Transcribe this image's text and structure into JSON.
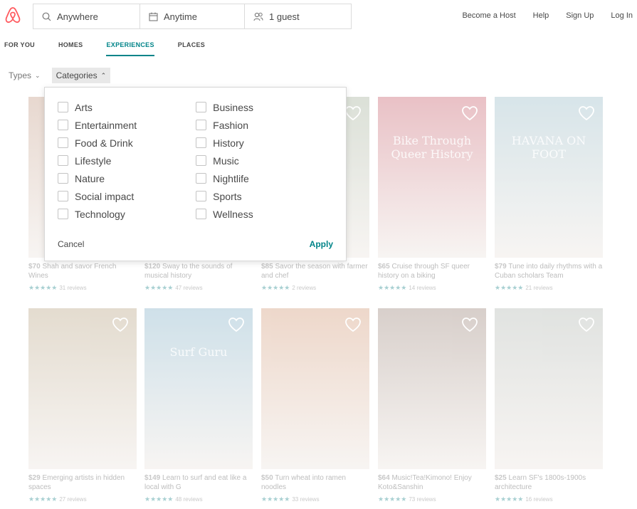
{
  "header": {
    "search": {
      "where": "Anywhere",
      "when": "Anytime",
      "guests": "1 guest"
    },
    "nav": [
      "Become a Host",
      "Help",
      "Sign Up",
      "Log In"
    ]
  },
  "tabs": [
    {
      "label": "FOR YOU",
      "active": false
    },
    {
      "label": "HOMES",
      "active": false
    },
    {
      "label": "EXPERIENCES",
      "active": true
    },
    {
      "label": "PLACES",
      "active": false
    }
  ],
  "filters": {
    "types": "Types",
    "categories": "Categories"
  },
  "categories_panel": {
    "left": [
      "Arts",
      "Entertainment",
      "Food & Drink",
      "Lifestyle",
      "Nature",
      "Social impact",
      "Technology"
    ],
    "right": [
      "Business",
      "Fashion",
      "History",
      "Music",
      "Nightlife",
      "Sports",
      "Wellness"
    ],
    "cancel": "Cancel",
    "apply": "Apply"
  },
  "cards": [
    {
      "price": "$70",
      "title": "Shah and savor French Wines",
      "stars": "★★★★★",
      "reviews": "31 reviews",
      "color": "#d4b8a8",
      "overlay": ""
    },
    {
      "price": "$120",
      "title": "Sway to the sounds of musical history",
      "stars": "★★★★★",
      "reviews": "47 reviews",
      "color": "#c8c0b0",
      "overlay": ""
    },
    {
      "price": "$85",
      "title": "Savor the season with farmer and chef",
      "stars": "★★★★★",
      "reviews": "2 reviews",
      "color": "#bfc8b8",
      "overlay": ""
    },
    {
      "price": "$65",
      "title": "Cruise through SF queer history on a biking",
      "stars": "★★★★★",
      "reviews": "14 reviews",
      "color": "#d88f98",
      "overlay": "Bike Through Queer History"
    },
    {
      "price": "$79",
      "title": "Tune into daily rhythms with a Cuban scholars Team",
      "stars": "★★★★★",
      "reviews": "21 reviews",
      "color": "#b8d0d8",
      "overlay": "HAVANA ON FOOT"
    },
    {
      "price": "$29",
      "title": "Emerging artists in hidden spaces",
      "stars": "★★★★★",
      "reviews": "27 reviews",
      "color": "#cdbfa8",
      "overlay": ""
    },
    {
      "price": "$149",
      "title": "Learn to surf and eat like a local with G",
      "stars": "★★★★★",
      "reviews": "48 reviews",
      "color": "#a8c8d8",
      "overlay": "Surf Guru"
    },
    {
      "price": "$50",
      "title": "Turn wheat into ramen noodles",
      "stars": "★★★★★",
      "reviews": "33 reviews",
      "color": "#e0b8a0",
      "overlay": ""
    },
    {
      "price": "$64",
      "title": "Music!Tea!Kimono! Enjoy Koto&Sanshin",
      "stars": "★★★★★",
      "reviews": "73 reviews",
      "color": "#b8a8a0",
      "overlay": ""
    },
    {
      "price": "$25",
      "title": "Learn SF's 1800s-1900s architecture",
      "stars": "★★★★★",
      "reviews": "16 reviews",
      "color": "#c8ccc8",
      "overlay": ""
    }
  ],
  "colors": {
    "brand": "#FF5A5F",
    "accent": "#008489"
  }
}
